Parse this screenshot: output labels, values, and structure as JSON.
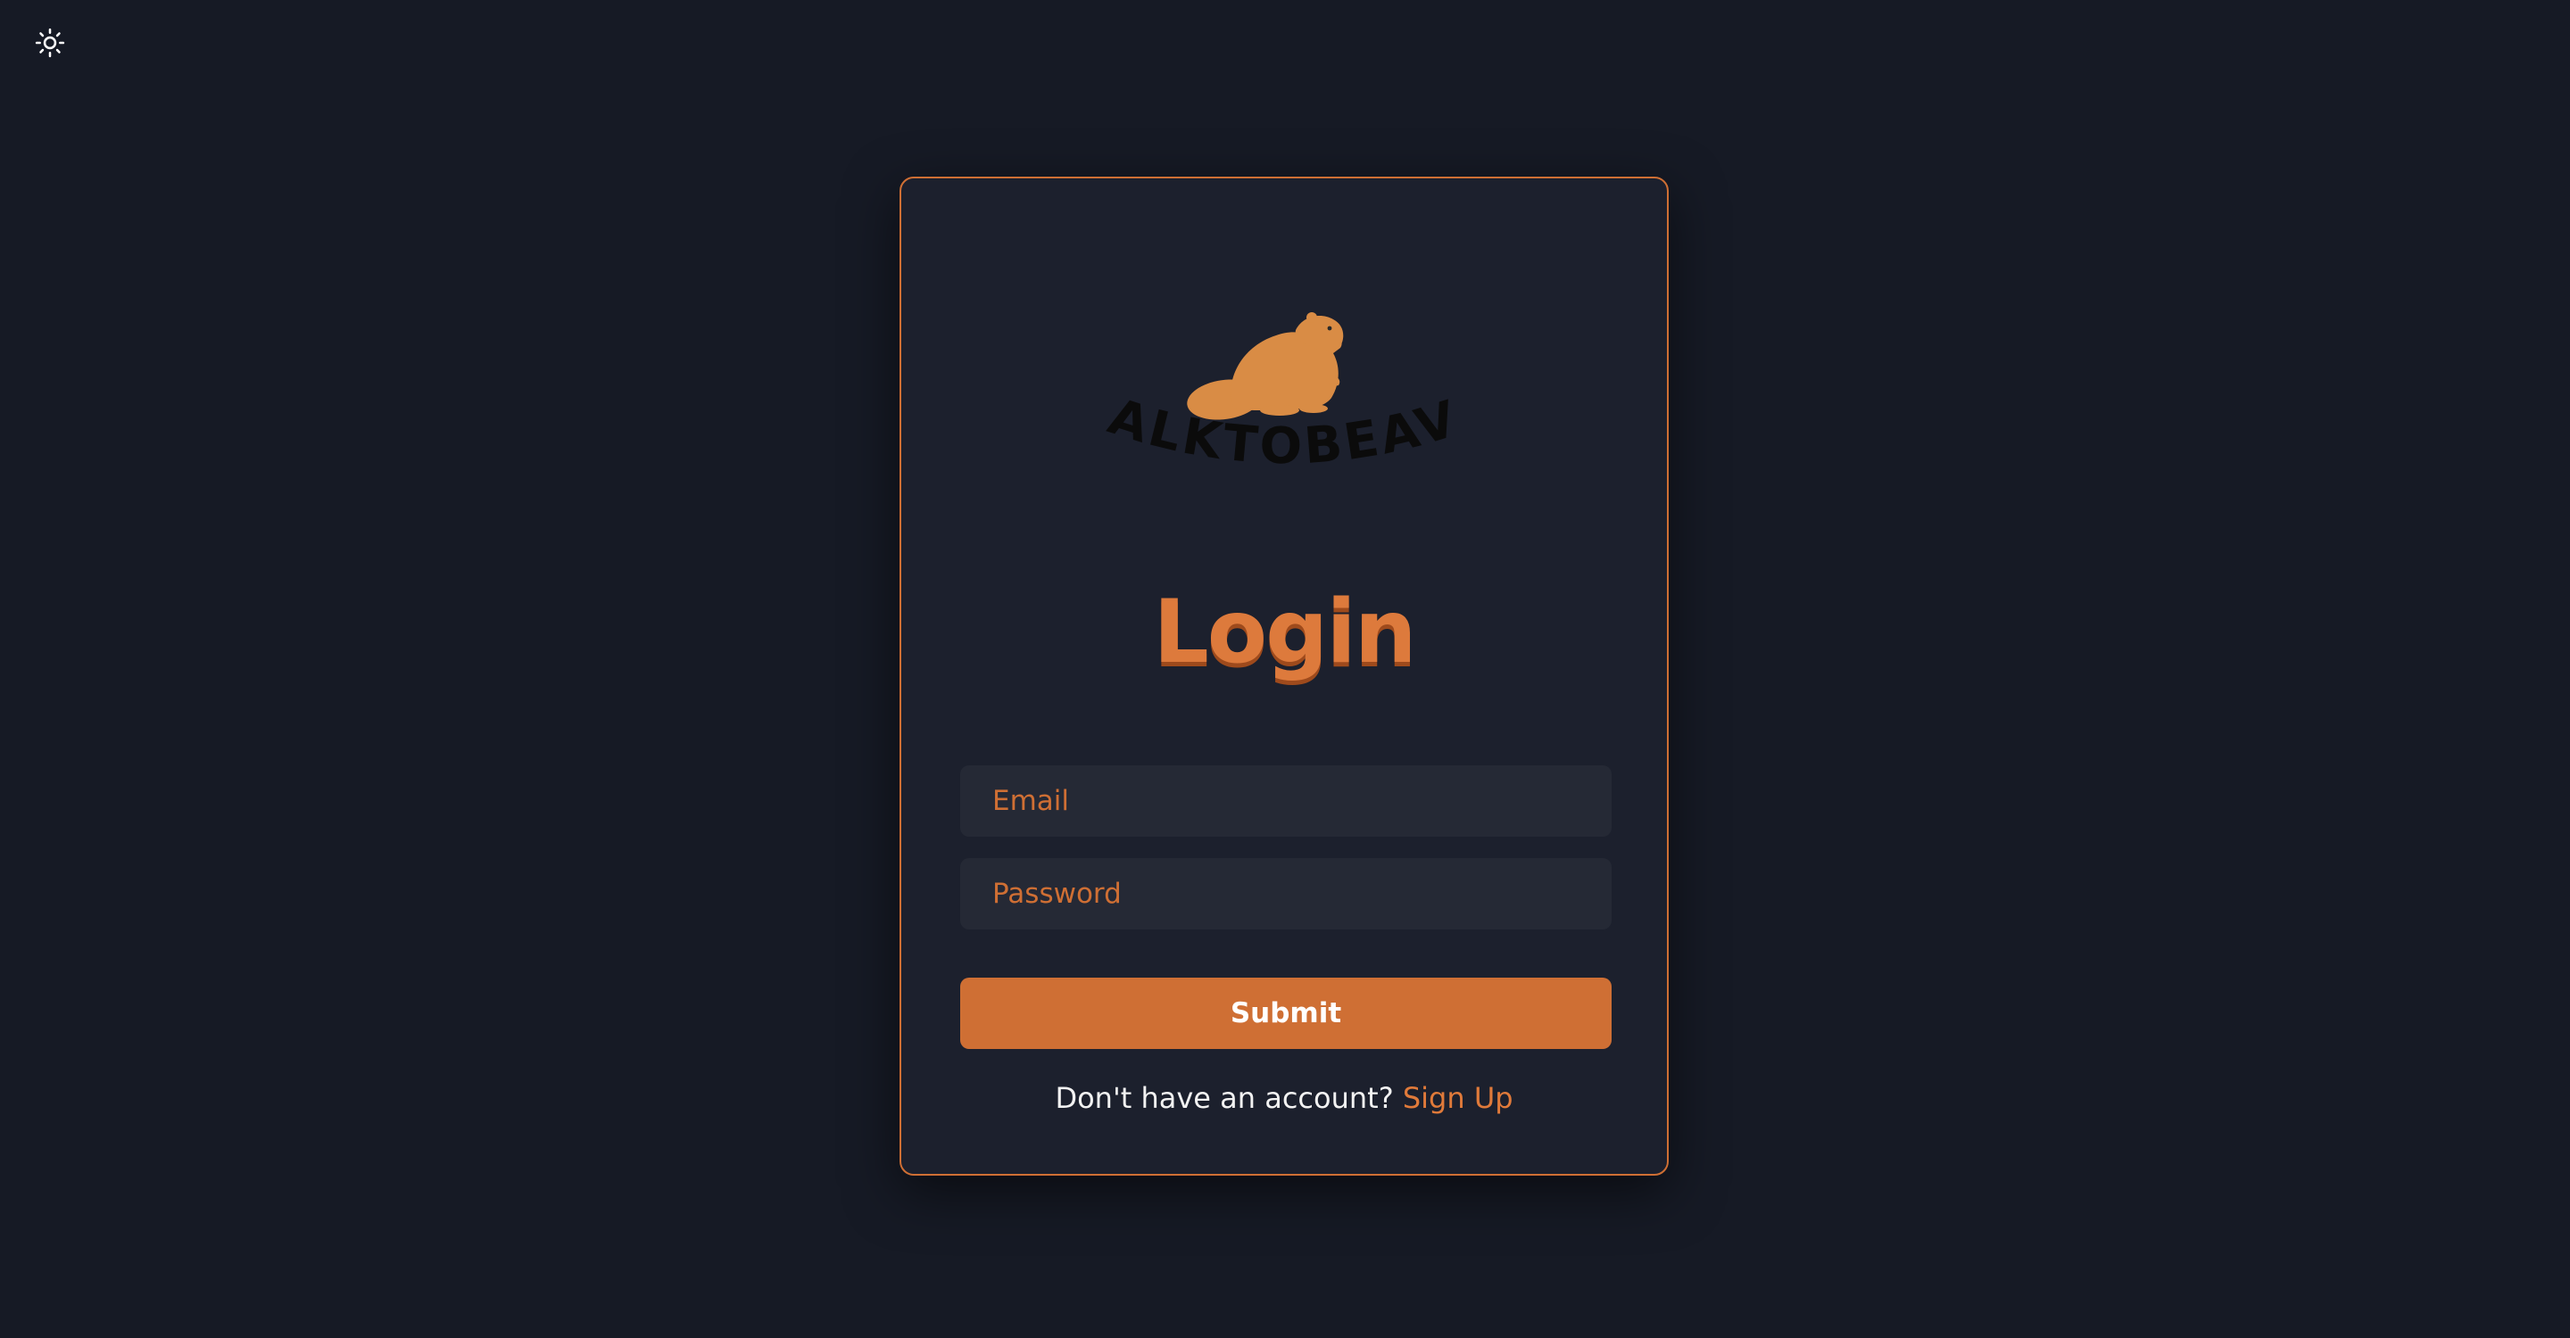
{
  "theme_toggle": {
    "icon": "sun-icon"
  },
  "logo": {
    "wordmark": "TALKTOBEAVS",
    "icon": "beaver-icon"
  },
  "form": {
    "title": "Login",
    "email_placeholder": "Email",
    "password_placeholder": "Password",
    "submit_label": "Submit",
    "signup_prompt": "Don't have an account?",
    "signup_link": "Sign Up"
  },
  "colors": {
    "background": "#161a25",
    "card": "#1c202d",
    "accent": "#cf6f34",
    "input_bg": "#252935",
    "text": "#f2f2f2"
  }
}
